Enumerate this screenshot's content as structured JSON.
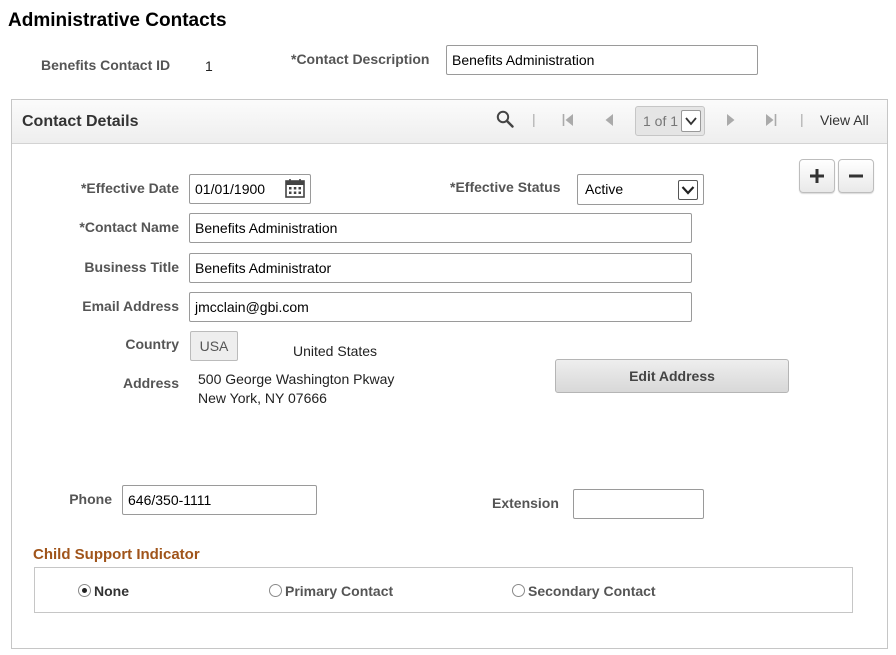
{
  "page": {
    "title": "Administrative Contacts"
  },
  "header": {
    "contact_id_label": "Benefits Contact ID",
    "contact_id_value": "1",
    "description_label": "*Contact Description",
    "description_value": "Benefits Administration"
  },
  "panel": {
    "title": "Contact Details",
    "pager_text": "1 of 1",
    "view_all": "View All",
    "separator": "|"
  },
  "form": {
    "effective_date_label": "*Effective Date",
    "effective_date_value": "01/01/1900",
    "effective_status_label": "*Effective Status",
    "effective_status_value": "Active",
    "contact_name_label": "*Contact Name",
    "contact_name_value": "Benefits Administration",
    "business_title_label": "Business Title",
    "business_title_value": "Benefits Administrator",
    "email_label": "Email Address",
    "email_value": "jmcclain@gbi.com",
    "country_label": "Country",
    "country_code": "USA",
    "country_name": "United States",
    "address_label": "Address",
    "address_line1": "500 George Washington Pkway",
    "address_line2": "New York, NY 07666",
    "edit_address": "Edit Address",
    "phone_label": "Phone",
    "phone_value": "646/350-1111",
    "extension_label": "Extension",
    "extension_value": ""
  },
  "child_support": {
    "title": "Child Support Indicator",
    "options": [
      {
        "label": "None",
        "selected": true
      },
      {
        "label": "Primary Contact",
        "selected": false
      },
      {
        "label": "Secondary Contact",
        "selected": false
      }
    ]
  },
  "colors": {
    "section_title": "#a0541a",
    "label_gray": "#555555"
  },
  "icons": [
    "search-icon",
    "first-page-icon",
    "previous-icon",
    "next-icon",
    "last-page-icon",
    "calendar-icon",
    "add-row-icon",
    "delete-row-icon",
    "dropdown-arrow-icon"
  ]
}
